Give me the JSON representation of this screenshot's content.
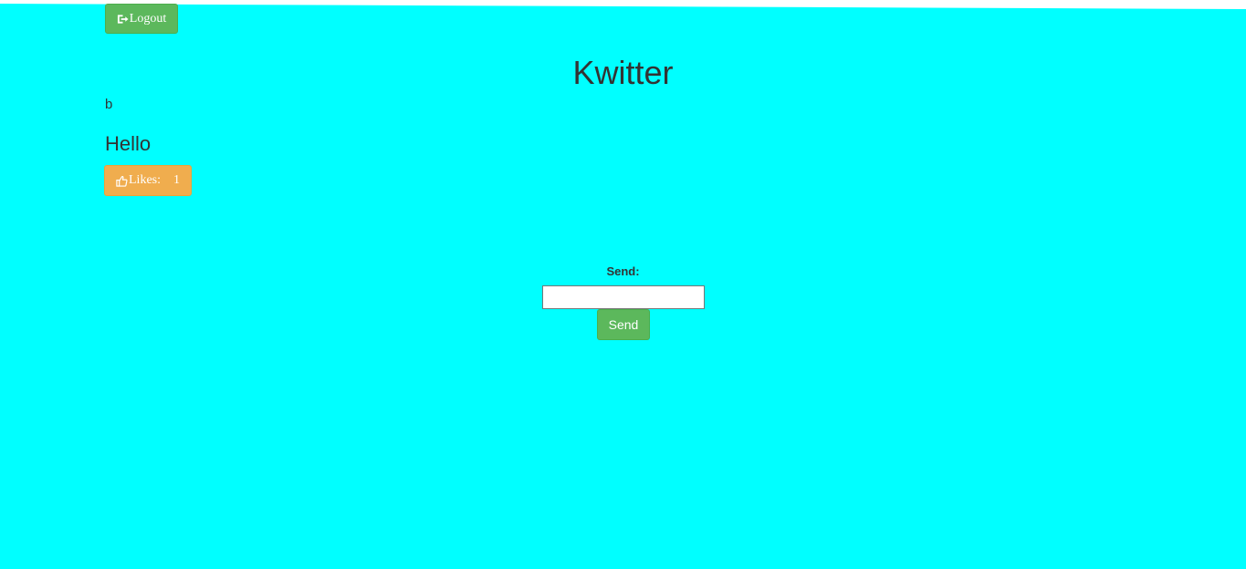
{
  "header": {
    "logout_label": "Logout",
    "logout_icon": "log-out-icon"
  },
  "app": {
    "title": "Kwitter"
  },
  "post": {
    "username": "b",
    "message": "Hello",
    "likes_label": "Likes:",
    "likes_count": "1",
    "like_icon": "thumbs-up-icon"
  },
  "composer": {
    "label": "Send:",
    "input_value": "",
    "send_label": "Send"
  },
  "colors": {
    "background": "#00ffff",
    "success": "#5cb85c",
    "warning": "#f0ad4e",
    "text": "#333333"
  }
}
